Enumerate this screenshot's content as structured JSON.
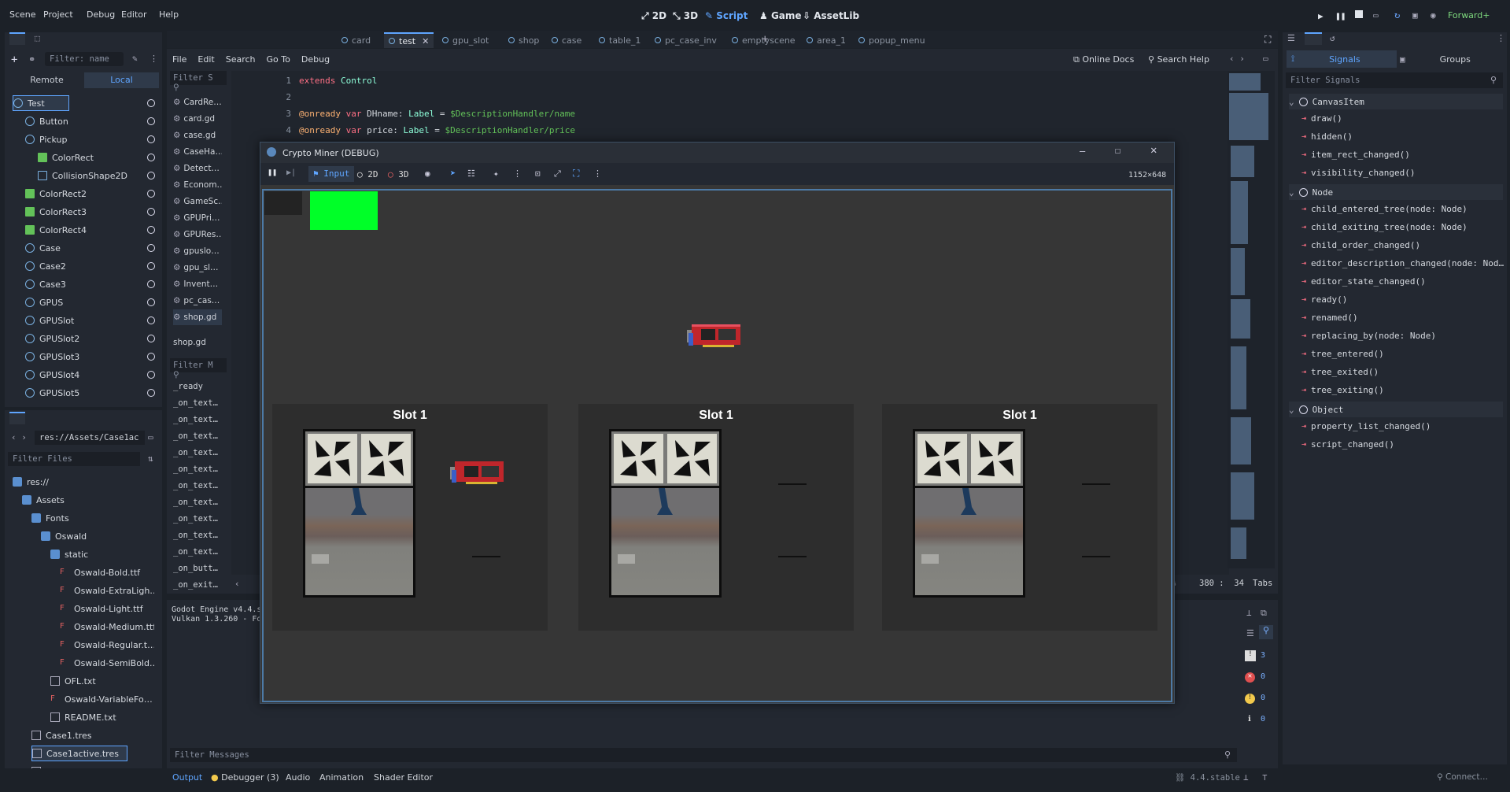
{
  "menu": [
    "Scene",
    "Project",
    "Debug",
    "Editor",
    "Help"
  ],
  "workspaces": [
    {
      "label": "2D",
      "active": false
    },
    {
      "label": "3D",
      "active": false
    },
    {
      "label": "Script",
      "active": true
    },
    {
      "label": "Game",
      "active": false
    },
    {
      "label": "AssetLib",
      "active": false
    }
  ],
  "renderer": "Forward+",
  "scene_tabs": [
    {
      "label": "card",
      "active": false
    },
    {
      "label": "test",
      "active": true
    },
    {
      "label": "gpu_slot",
      "active": false
    },
    {
      "label": "shop",
      "active": false
    },
    {
      "label": "case",
      "active": false
    },
    {
      "label": "table_1",
      "active": false
    },
    {
      "label": "pc_case_inv",
      "active": false
    },
    {
      "label": "emptyscene",
      "active": false
    },
    {
      "label": "area_1",
      "active": false
    },
    {
      "label": "popup_menu",
      "active": false
    }
  ],
  "scene_dock": {
    "filter_placeholder": "Filter: name",
    "remote_label": "Remote",
    "local_label": "Local",
    "nodes": [
      {
        "label": "Test",
        "depth": 0,
        "selected": true
      },
      {
        "label": "Button",
        "depth": 1
      },
      {
        "label": "Pickup",
        "depth": 1
      },
      {
        "label": "ColorRect",
        "depth": 2
      },
      {
        "label": "CollisionShape2D",
        "depth": 2
      },
      {
        "label": "ColorRect2",
        "depth": 1
      },
      {
        "label": "ColorRect3",
        "depth": 1
      },
      {
        "label": "ColorRect4",
        "depth": 1
      },
      {
        "label": "Case",
        "depth": 1
      },
      {
        "label": "Case2",
        "depth": 1
      },
      {
        "label": "Case3",
        "depth": 1
      },
      {
        "label": "GPUS",
        "depth": 1
      },
      {
        "label": "GPUSlot",
        "depth": 1
      },
      {
        "label": "GPUSlot2",
        "depth": 1
      },
      {
        "label": "GPUSlot3",
        "depth": 1
      },
      {
        "label": "GPUSlot4",
        "depth": 1
      },
      {
        "label": "GPUSlot5",
        "depth": 1
      }
    ]
  },
  "filesystem": {
    "path": "res://Assets/Case1ac",
    "filter_placeholder": "Filter Files",
    "items": [
      {
        "label": "res://",
        "depth": 0
      },
      {
        "label": "Assets",
        "depth": 1
      },
      {
        "label": "Fonts",
        "depth": 2
      },
      {
        "label": "Oswald",
        "depth": 3
      },
      {
        "label": "static",
        "depth": 4
      },
      {
        "label": "Oswald-Bold.ttf",
        "depth": 5
      },
      {
        "label": "Oswald-ExtraLigh…",
        "depth": 5
      },
      {
        "label": "Oswald-Light.ttf",
        "depth": 5
      },
      {
        "label": "Oswald-Medium.ttf",
        "depth": 5
      },
      {
        "label": "Oswald-Regular.t…",
        "depth": 5
      },
      {
        "label": "Oswald-SemiBold.…",
        "depth": 5
      },
      {
        "label": "OFL.txt",
        "depth": 4
      },
      {
        "label": "Oswald-VariableFo…",
        "depth": 4
      },
      {
        "label": "README.txt",
        "depth": 4
      },
      {
        "label": "Case1.tres",
        "depth": 2
      },
      {
        "label": "Case1active.tres",
        "depth": 2,
        "selected": true
      },
      {
        "label": "Case2.tres",
        "depth": 2
      }
    ]
  },
  "script_editor": {
    "menus": [
      "File",
      "Edit",
      "Search",
      "Go To",
      "Debug"
    ],
    "online_docs": "Online Docs",
    "search_help": "Search Help",
    "filter_scripts": "Filter S",
    "scripts": [
      "CardRe…",
      "card.gd",
      "case.gd",
      "CaseHa…",
      "Detect…",
      "Econom…",
      "GameSc…",
      "GPUPri…",
      "GPURes…",
      "gpuslo…",
      "gpu_sl…",
      "Invent…",
      "pc_cas…",
      "shop.gd"
    ],
    "current_script": "shop.gd",
    "filter_methods": "Filter M",
    "methods": [
      "_ready",
      "_on_text…",
      "_on_text…",
      "_on_text…",
      "_on_text…",
      "_on_text…",
      "_on_text…",
      "_on_text…",
      "_on_text…",
      "_on_text…",
      "_on_text…",
      "_on_butt…",
      "_on_exit…"
    ],
    "line_numbers": [
      "1",
      "2",
      "3",
      "4"
    ],
    "status_pos": "380 :  34",
    "status_indent": "Tabs",
    "status_zoom": "%"
  },
  "output": {
    "line1": "Godot Engine v4.4.st",
    "line2": "Vulkan 1.3.260 - For",
    "filter_placeholder": "Filter Messages",
    "counts": [
      "3",
      "0",
      "0",
      "0"
    ]
  },
  "bottom_tabs": [
    "Output",
    "Debugger (3)",
    "Audio",
    "Animation",
    "Shader Editor"
  ],
  "version": "4.4.stable",
  "connect_label": "Connect…",
  "signals_dock": {
    "tab_signals": "Signals",
    "tab_groups": "Groups",
    "filter_placeholder": "Filter Signals",
    "sections": [
      {
        "title": "CanvasItem",
        "signals": [
          "draw()",
          "hidden()",
          "item_rect_changed()",
          "visibility_changed()"
        ]
      },
      {
        "title": "Node",
        "signals": [
          "child_entered_tree(node: Node)",
          "child_exiting_tree(node: Node)",
          "child_order_changed()",
          "editor_description_changed(node: Nod…",
          "editor_state_changed()",
          "ready()",
          "renamed()",
          "replacing_by(node: Node)",
          "tree_entered()",
          "tree_exited()",
          "tree_exiting()"
        ]
      },
      {
        "title": "Object",
        "signals": [
          "property_list_changed()",
          "script_changed()"
        ]
      }
    ]
  },
  "game_window": {
    "title": "Crypto Miner (DEBUG)",
    "input_label": "Input",
    "mode_2d": "2D",
    "mode_3d": "3D",
    "resolution": "1152×648",
    "slots": [
      {
        "title": "Slot 1"
      },
      {
        "title": "Slot 1"
      },
      {
        "title": "Slot 1"
      }
    ]
  }
}
